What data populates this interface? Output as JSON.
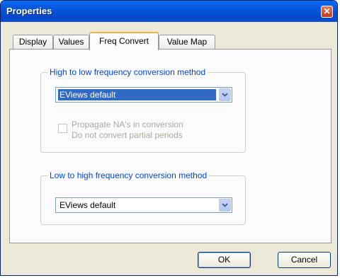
{
  "window": {
    "title": "Properties",
    "close_glyph": "✕"
  },
  "tabs": [
    {
      "label": "Display"
    },
    {
      "label": "Values"
    },
    {
      "label": "Freq Convert"
    },
    {
      "label": "Value Map"
    }
  ],
  "high_to_low": {
    "label": "High to low frequency conversion method",
    "selected": "EViews default",
    "propagate_na": {
      "label": "Propagate NA's in conversion",
      "checked": false,
      "enabled": false
    },
    "no_partial": {
      "label": "Do not convert partial periods"
    }
  },
  "low_to_high": {
    "label": "Low to high frequency conversion method",
    "selected": "EViews default"
  },
  "buttons": {
    "ok": "OK",
    "cancel": "Cancel"
  },
  "colors": {
    "titlebar": "#0553db",
    "group_label": "#0046d5",
    "selection": "#316ac5",
    "active_tab_accent": "#f8b33c"
  },
  "icons": {
    "close": "close-icon",
    "dropdown": "chevron-down-icon"
  }
}
